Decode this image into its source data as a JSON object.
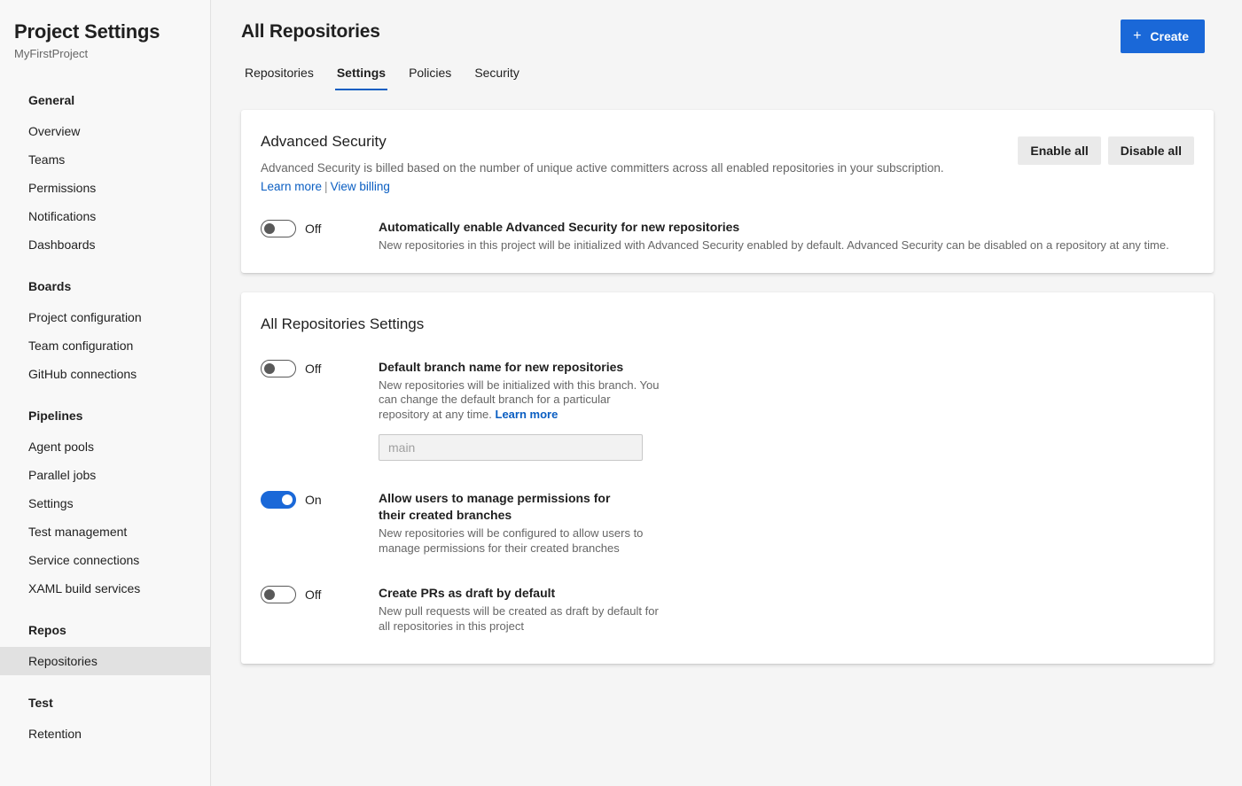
{
  "sidebar": {
    "title": "Project Settings",
    "subtitle": "MyFirstProject",
    "groups": [
      {
        "header": "General",
        "items": [
          {
            "label": "Overview",
            "selected": false
          },
          {
            "label": "Teams",
            "selected": false
          },
          {
            "label": "Permissions",
            "selected": false
          },
          {
            "label": "Notifications",
            "selected": false
          },
          {
            "label": "Dashboards",
            "selected": false
          }
        ]
      },
      {
        "header": "Boards",
        "items": [
          {
            "label": "Project configuration",
            "selected": false
          },
          {
            "label": "Team configuration",
            "selected": false
          },
          {
            "label": "GitHub connections",
            "selected": false
          }
        ]
      },
      {
        "header": "Pipelines",
        "items": [
          {
            "label": "Agent pools",
            "selected": false
          },
          {
            "label": "Parallel jobs",
            "selected": false
          },
          {
            "label": "Settings",
            "selected": false
          },
          {
            "label": "Test management",
            "selected": false
          },
          {
            "label": "Service connections",
            "selected": false
          },
          {
            "label": "XAML build services",
            "selected": false
          }
        ]
      },
      {
        "header": "Repos",
        "items": [
          {
            "label": "Repositories",
            "selected": true
          }
        ]
      },
      {
        "header": "Test",
        "items": [
          {
            "label": "Retention",
            "selected": false
          }
        ]
      }
    ]
  },
  "header": {
    "title": "All Repositories",
    "create_label": "Create",
    "create_icon": "plus-icon",
    "tabs": [
      {
        "label": "Repositories",
        "active": false
      },
      {
        "label": "Settings",
        "active": true
      },
      {
        "label": "Policies",
        "active": false
      },
      {
        "label": "Security",
        "active": false
      }
    ]
  },
  "advanced_security": {
    "title": "Advanced Security",
    "description": "Advanced Security is billed based on the number of unique active committers across all enabled repositories in your subscription.",
    "learn_more_label": "Learn more",
    "link_separator": "|",
    "view_billing_label": "View billing",
    "enable_all_label": "Enable all",
    "disable_all_label": "Disable all",
    "setting": {
      "toggle_state": "Off",
      "title": "Automatically enable Advanced Security for new repositories",
      "description": "New repositories in this project will be initialized with Advanced Security enabled by default. Advanced Security can be disabled on a repository at any time."
    }
  },
  "all_repositories_settings": {
    "title": "All Repositories Settings",
    "settings": [
      {
        "toggle_state": "Off",
        "on": false,
        "title": "Default branch name for new repositories",
        "description": "New repositories will be initialized with this branch. You can change the default branch for a particular repository at any time.",
        "inline_link": "Learn more",
        "input_placeholder": "main",
        "input_value": ""
      },
      {
        "toggle_state": "On",
        "on": true,
        "title": "Allow users to manage permissions for their created branches",
        "description": "New repositories will be configured to allow users to manage permissions for their created branches"
      },
      {
        "toggle_state": "Off",
        "on": false,
        "title": "Create PRs as draft by default",
        "description": "New pull requests will be created as draft by default for all repositories in this project"
      }
    ]
  },
  "colors": {
    "accent": "#1a68d8",
    "link": "#0a5ec2",
    "tab_underline": "#0a5ec2",
    "page_background": "#f5f5f5",
    "sidebar_background": "#f8f8f8",
    "selected_item": "#e1e1e1"
  }
}
